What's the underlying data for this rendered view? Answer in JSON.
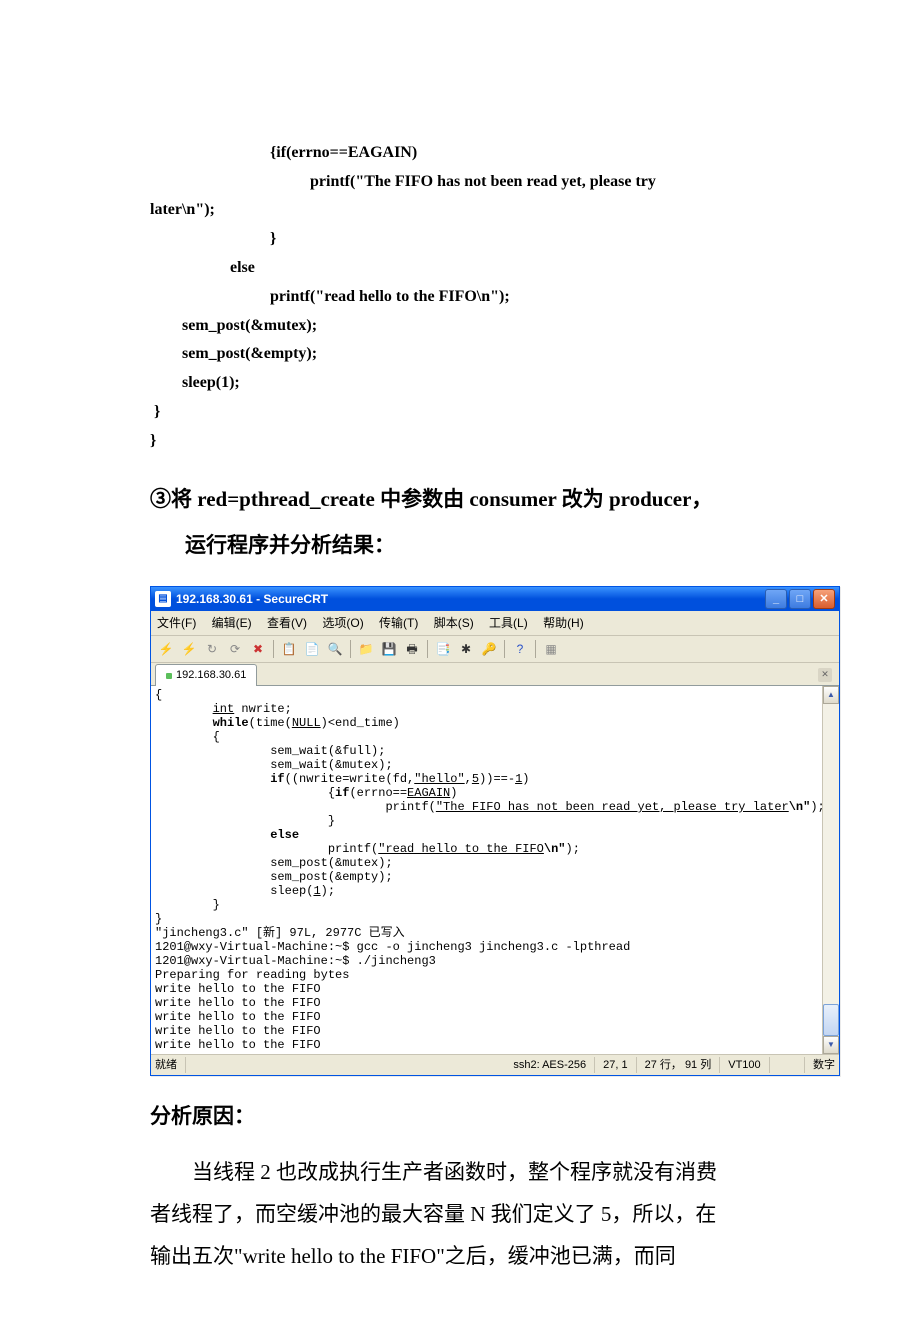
{
  "code": {
    "l1": "                              {if(errno==EAGAIN)",
    "l2": "                                        printf(\"The FIFO has not been read yet, please try",
    "l3": "later\\n\");",
    "l4": "                              }",
    "l5": "                    else",
    "l6": "                              printf(\"read hello to the FIFO\\n\");",
    "l7": "        sem_post(&mutex);",
    "l8": "        sem_post(&empty);",
    "l9": "        sleep(1);",
    "l10": " }",
    "l11": "}"
  },
  "instruction": {
    "circ": "③",
    "line1a": "将 ",
    "line1b": "red=pthread_create ",
    "line1c": "中参数由 ",
    "line1d": "consumer ",
    "line1e": "改为 ",
    "line1f": "producer",
    "line1g": "，",
    "line2": "运行程序并分析结果："
  },
  "crt": {
    "title": "192.168.30.61 - SecureCRT",
    "menus": {
      "file": "文件(F)",
      "edit": "编辑(E)",
      "view": "查看(V)",
      "options": "选项(O)",
      "transfer": "传输(T)",
      "script": "脚本(S)",
      "tools": "工具(L)",
      "help": "帮助(H)"
    },
    "tab": "192.168.30.61",
    "status": {
      "ready": "就绪",
      "proto": "ssh2: AES-256",
      "pos": "27,   1",
      "rowscols": "27 行， 91 列",
      "term": "VT100",
      "num": "数字"
    }
  },
  "term": {
    "l1": "{",
    "l2a": "        ",
    "l2b": "int",
    "l2c": " nwrite;",
    "l3a": "        ",
    "l3b": "while",
    "l3c": "(time(",
    "l3d": "NULL",
    "l3e": ")<end_time)",
    "l4": "        {",
    "l5": "                sem_wait(&full);",
    "l6": "                sem_wait(&mutex);",
    "l7a": "                ",
    "l7b": "if",
    "l7c": "((nwrite=write(fd,",
    "l7d": "\"hello\"",
    "l7e": ",",
    "l7f": "5",
    "l7g": "))==-",
    "l7h": "1",
    "l7i": ")",
    "l8a": "                        {",
    "l8b": "if",
    "l8c": "(errno==",
    "l8d": "EAGAIN",
    "l8e": ")",
    "l9a": "                                printf(",
    "l9b": "\"The FIFO has not been read yet, please try later",
    "l9c": "\\n\"",
    "l9d": ")",
    "l10": "                        }",
    "l11a": "                ",
    "l11b": "else",
    "l12a": "                        printf(",
    "l12b": "\"read hello to the FIFO",
    "l12c": "\\n\"",
    "l12d": ");",
    "l13": "                sem_post(&mutex);",
    "l14": "                sem_post(&empty);",
    "l15a": "                sleep(",
    "l15b": "1",
    "l15c": ");",
    "l16": "        }",
    "l17": "}",
    "l18": "\"jincheng3.c\" [新] 97L, 2977C 已写入",
    "l19": "1201@wxy-Virtual-Machine:~$ gcc -o jincheng3 jincheng3.c -lpthread",
    "l20": "1201@wxy-Virtual-Machine:~$ ./jincheng3",
    "l21": "Preparing for reading bytes",
    "l22": "write hello to the FIFO",
    "l23": "write hello to the FIFO",
    "l24": "write hello to the FIFO",
    "l25": "write hello to the FIFO",
    "l26": "write hello to the FIFO"
  },
  "after": {
    "heading": "分析原因：",
    "p1a": "当线程 2 也改成执行生产者函数时，整个程序就没有消费",
    "p2a": "者线程了，而空缓冲池的最大容量 N 我们定义了 5，所以，在",
    "p3a": "输出五次\"",
    "p3b": "write hello to the FIFO",
    "p3c": "\"之后，缓冲池已满，而同"
  }
}
